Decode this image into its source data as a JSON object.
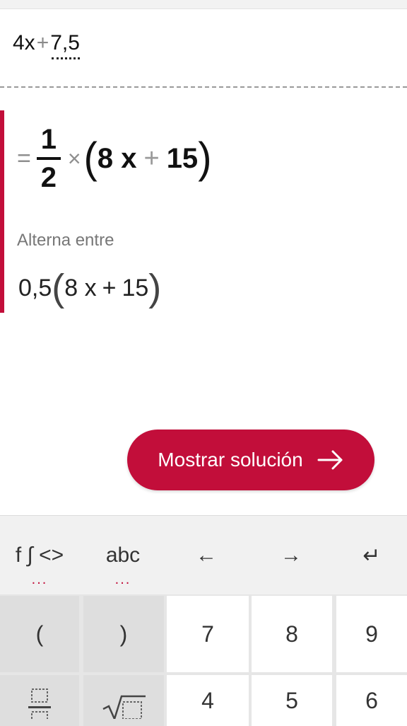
{
  "input": {
    "term1": "4x",
    "op": "+",
    "term2": "7,5"
  },
  "result": {
    "equals": "=",
    "numerator": "1",
    "denominator": "2",
    "times": "×",
    "open_paren": "(",
    "term_a": "8 x",
    "plus": "+",
    "term_b": "15",
    "close_paren": ")"
  },
  "alternate": {
    "label": "Alterna entre",
    "coef": "0,5",
    "open_paren": "(",
    "term_a": "8 x",
    "plus": "+",
    "term_b": "15",
    "close_paren": ")"
  },
  "show_solution_label": "Mostrar solución",
  "keyboard": {
    "tabs": [
      {
        "label": "f ∫ <>",
        "dots": "..."
      },
      {
        "label": "abc",
        "dots": "..."
      },
      {
        "label": "←"
      },
      {
        "label": "→"
      },
      {
        "label": "↵"
      }
    ],
    "row1": [
      "(",
      ")",
      "7",
      "8",
      "9"
    ],
    "row2": [
      "4",
      "5",
      "6"
    ]
  },
  "colors": {
    "accent": "#c20e3a"
  }
}
